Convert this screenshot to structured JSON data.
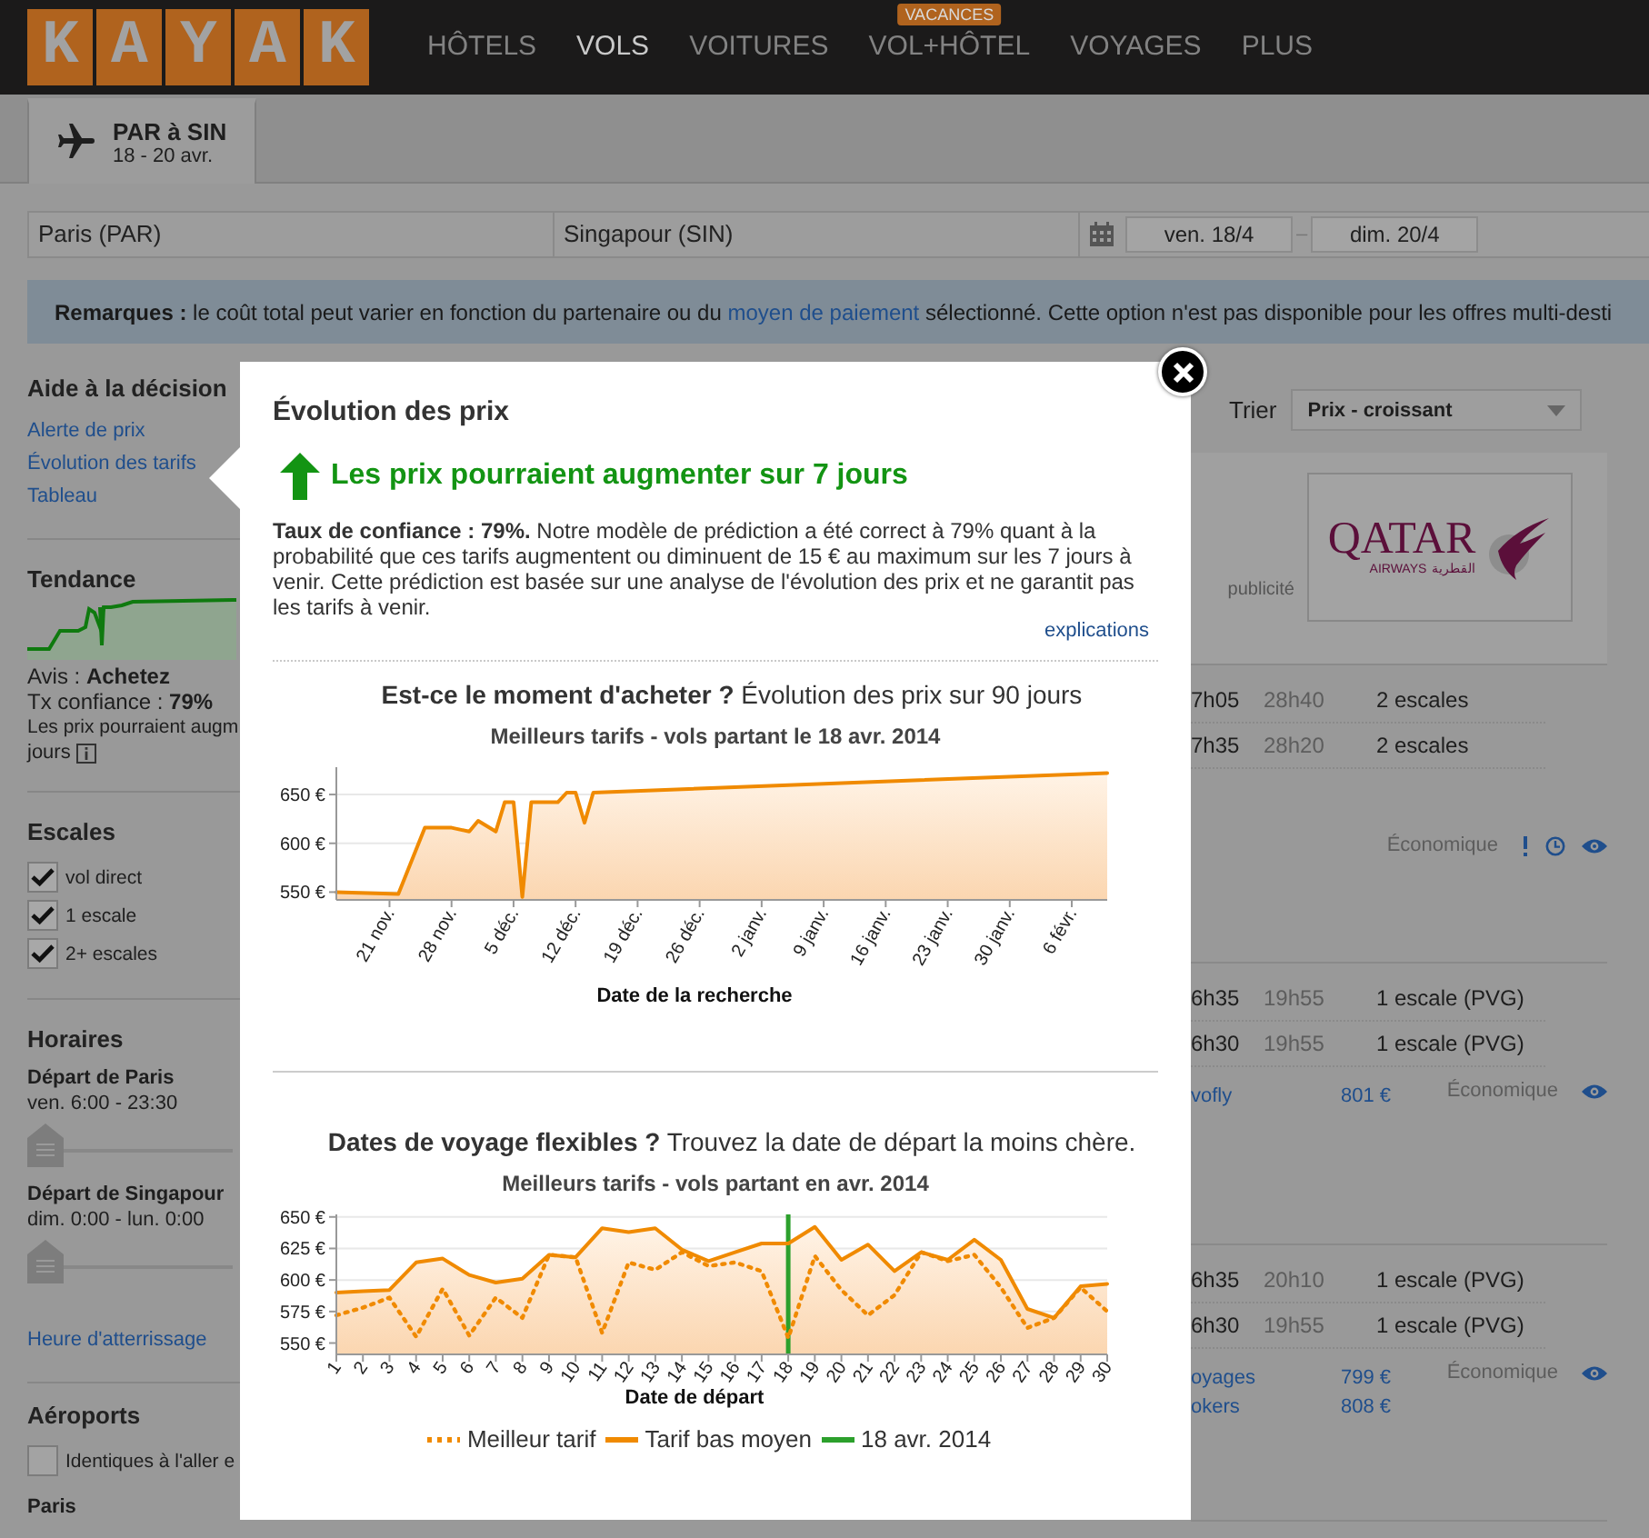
{
  "header": {
    "logo": "KAYAK",
    "nav": [
      {
        "label": "HÔTELS",
        "selected": false
      },
      {
        "label": "VOLS",
        "selected": true
      },
      {
        "label": "VOITURES",
        "selected": false
      },
      {
        "label": "VOL+HÔTEL",
        "selected": false,
        "badge": "VACANCES"
      },
      {
        "label": "VOYAGES",
        "selected": false
      },
      {
        "label": "PLUS",
        "selected": false
      }
    ]
  },
  "trip_tabs": [
    {
      "title": "PAR à SIN",
      "dates": "18 - 20 avr.",
      "selected": true
    }
  ],
  "search": {
    "origin": "Paris (PAR)",
    "destination": "Singapour (SIN)",
    "depart": "ven. 18/4",
    "separator": "–",
    "return": "dim. 20/4"
  },
  "notice": {
    "before": "**Remarques :** le coût total peut varier en fonction du partenaire ou du ",
    "link": "moyen de paiement",
    "after": " sélectionné. Cette option n'est pas disponible pour les offres multi-desti"
  },
  "sidebar": {
    "decision": {
      "title": "Aide à la décision",
      "links": [
        "Alerte de prix",
        "Évolution des tarifs",
        "Tableau"
      ]
    },
    "trend": {
      "title": "Tendance",
      "advice": "Avis : **Achetez**",
      "confidence": "Tx confiance : **79%**",
      "note": "Les prix pourraient augm",
      "note_end": "jours"
    },
    "stops": {
      "title": "Escales",
      "options": [
        {
          "label": "vol direct",
          "checked": true
        },
        {
          "label": "1 escale",
          "checked": true
        },
        {
          "label": "2+ escales",
          "checked": true
        }
      ]
    },
    "schedule": {
      "title": "Horaires",
      "sliders": [
        {
          "label": "Départ de Paris",
          "range": "ven. 6:00 - 23:30",
          "level": 0
        },
        {
          "label": "Départ de Singapour",
          "range": "dim. 0:00 - lun. 0:00",
          "level": 0
        }
      ],
      "link": "Heure d'atterrissage"
    },
    "airports": {
      "title": "Aéroports",
      "options": [
        {
          "label": "Identiques à l'aller e",
          "checked": false
        }
      ],
      "city": "Paris"
    }
  },
  "results": {
    "sort_label": "Trier",
    "sort_value": "Prix - croissant",
    "ad": {
      "label": "publicité",
      "logo": "QATAR",
      "logo_sub": "AIRWAYS",
      "logo_arabic": "القطرية"
    },
    "groups": [
      {
        "kind": "notices",
        "legs": [
          {
            "time": "7h05",
            "duration": "28h40",
            "stops": "2 escales"
          },
          {
            "time": "7h35",
            "duration": "28h20",
            "stops": "2 escales"
          }
        ],
        "cabin": "Économique"
      },
      {
        "kind": "plain",
        "legs": [
          {
            "time": "6h35",
            "duration": "19h55",
            "stops": "1 escale (PVG)"
          },
          {
            "time": "6h30",
            "duration": "19h55",
            "stops": "1 escale (PVG)"
          }
        ],
        "offers": [
          {
            "partner": "vofly",
            "price": "801 €"
          }
        ],
        "cabin": "Économique"
      },
      {
        "kind": "plain",
        "legs": [
          {
            "time": "6h35",
            "duration": "20h10",
            "stops": "1 escale (PVG)"
          },
          {
            "time": "6h30",
            "duration": "19h55",
            "stops": "1 escale (PVG)"
          }
        ],
        "offers": [
          {
            "partner": "oyages",
            "price": "799 €"
          },
          {
            "partner": "okers",
            "price": "808 €"
          }
        ],
        "cabin": "Économique"
      }
    ]
  },
  "modal": {
    "title": "Évolution des prix",
    "headline": "Les prix pourraient augmenter sur 7 jours",
    "body": "**Taux de confiance : 79%.** Notre modèle de prédiction a été correct à 79% quant à la probabilité que ces tarifs augmentent ou diminuent de 15 € au maximum sur les 7 jours à venir. Cette prédiction est basée sur une analyse de l'évolution des prix et ne garantit pas les tarifs à venir.",
    "link": "explications",
    "sections": [
      {
        "heading": "**Est-ce le moment d'acheter ?** Évolution des prix sur 90 jours",
        "chart_data": {
          "type": "area",
          "title": "Meilleurs tarifs - vols partant le 18 avr. 2014",
          "xlabel": "Date de la recherche",
          "x": [
            "2013-11-15",
            "2013-11-22",
            "2013-11-25",
            "2013-11-28",
            "2013-11-30",
            "2013-12-01",
            "2013-12-03",
            "2013-12-04",
            "2013-12-05",
            "2013-12-06",
            "2013-12-07",
            "2013-12-10",
            "2013-12-11",
            "2013-12-12",
            "2013-12-13",
            "2013-12-14",
            "2014-02-10"
          ],
          "values": [
            550,
            548,
            616,
            616,
            612,
            623,
            612,
            642,
            642,
            545,
            642,
            642,
            652,
            652,
            621,
            652,
            672
          ],
          "xlim": [
            "2013-11-15",
            "2014-02-10"
          ],
          "ylim": [
            542,
            678
          ],
          "grid": true,
          "xticks": [
            {
              "value": "2013-11-21",
              "label": "21 nov."
            },
            {
              "value": "2013-11-28",
              "label": "28 nov."
            },
            {
              "value": "2013-12-05",
              "label": "5 déc."
            },
            {
              "value": "2013-12-12",
              "label": "12 déc."
            },
            {
              "value": "2013-12-19",
              "label": "19 déc."
            },
            {
              "value": "2013-12-26",
              "label": "26 déc."
            },
            {
              "value": "2014-01-02",
              "label": "2 janv."
            },
            {
              "value": "2014-01-09",
              "label": "9 janv."
            },
            {
              "value": "2014-01-16",
              "label": "16 janv."
            },
            {
              "value": "2014-01-23",
              "label": "23 janv."
            },
            {
              "value": "2014-01-30",
              "label": "30 janv."
            },
            {
              "value": "2014-02-06",
              "label": "6 févr."
            }
          ],
          "yticks": [
            {
              "value": 550,
              "label": "550 €"
            },
            {
              "value": 600,
              "label": "600 €"
            },
            {
              "value": 650,
              "label": "650 €"
            }
          ]
        }
      },
      {
        "heading": "**Dates de voyage flexibles ?** Trouvez la date de départ la moins chère.",
        "chart_data": {
          "type": "area",
          "grid": true,
          "legend": "bottom",
          "title": "Meilleurs tarifs - vols partant en avr. 2014",
          "xlabel": "Date de départ",
          "categories": [
            "1",
            "2",
            "3",
            "4",
            "5",
            "6",
            "7",
            "8",
            "9",
            "10",
            "11",
            "12",
            "13",
            "14",
            "15",
            "16",
            "17",
            "18",
            "19",
            "20",
            "21",
            "22",
            "23",
            "24",
            "25",
            "26",
            "27",
            "28",
            "29",
            "30"
          ],
          "series": [
            {
              "name": "Meilleur tarif",
              "type": "line",
              "color": "#f08a00",
              "line_style": "dotted",
              "values": [
                572,
                578,
                586,
                555,
                593,
                556,
                586,
                570,
                620,
                618,
                558,
                614,
                608,
                622,
                611,
                614,
                607,
                554,
                619,
                592,
                572,
                588,
                622,
                615,
                620,
                594,
                562,
                570,
                594,
                575
              ]
            },
            {
              "name": "Tarif bas moyen",
              "type": "area",
              "color": "#f08a00",
              "line_style": "solid",
              "values": [
                590,
                591,
                592,
                614,
                617,
                604,
                598,
                601,
                620,
                618,
                641,
                638,
                641,
                624,
                615,
                622,
                629,
                629,
                642,
                616,
                628,
                607,
                622,
                616,
                632,
                616,
                577,
                570,
                595,
                597
              ]
            }
          ],
          "ylim": [
            541,
            652
          ],
          "yticks": [
            {
              "value": 550,
              "label": "550 €"
            },
            {
              "value": 575,
              "label": "575 €"
            },
            {
              "value": 600,
              "label": "600 €"
            },
            {
              "value": 625,
              "label": "625 €"
            },
            {
              "value": 650,
              "label": "650 €"
            }
          ],
          "ref_lines": [
            {
              "axis": "x",
              "value": "18",
              "label": "18 avr. 2014",
              "color": "#2ca02c"
            }
          ]
        }
      }
    ]
  }
}
